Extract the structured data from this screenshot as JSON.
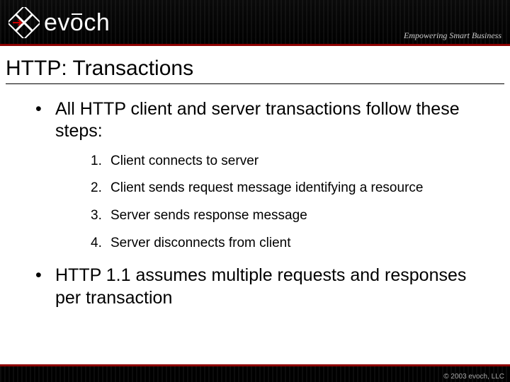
{
  "header": {
    "brand": "evōch",
    "tagline": "Empowering Smart Business"
  },
  "title": "HTTP: Transactions",
  "bullets": {
    "intro": "All HTTP client and server transactions follow these steps:",
    "steps": [
      "Client connects to server",
      "Client sends request message identifying a resource",
      "Server sends response message",
      "Server disconnects from client"
    ],
    "closing": "HTTP 1.1 assumes multiple requests and responses per transaction"
  },
  "footer": {
    "copyright": "© 2003  evoch, LLC"
  }
}
